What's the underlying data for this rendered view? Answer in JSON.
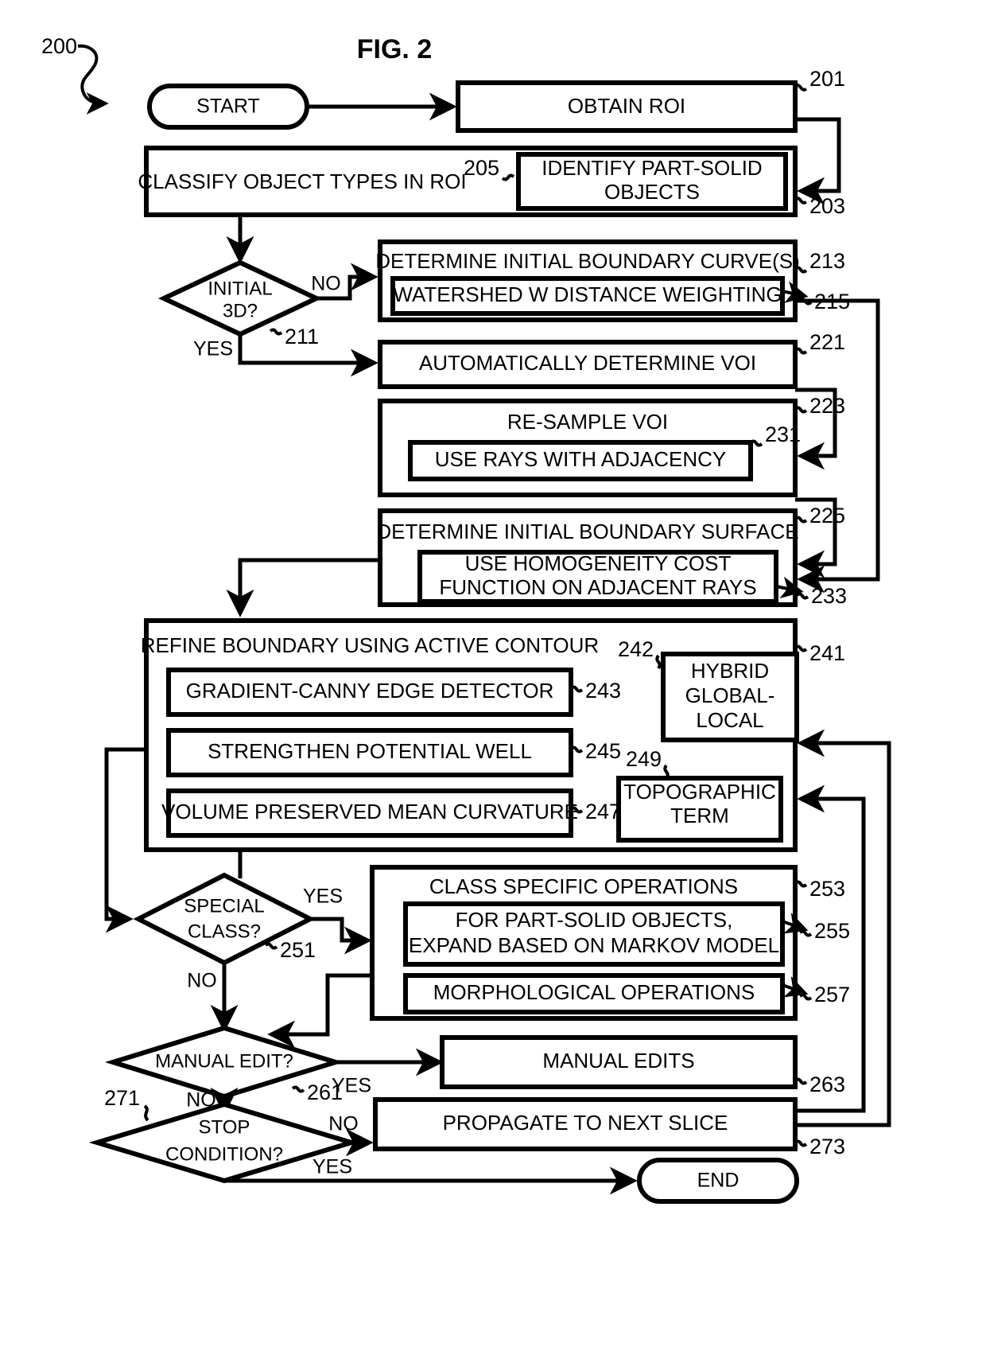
{
  "figure": {
    "title": "FIG. 2",
    "diagram_ref": "200"
  },
  "terminators": {
    "start": "START",
    "end": "END"
  },
  "nodes": {
    "obtain_roi": {
      "label": "OBTAIN ROI",
      "ref": "201"
    },
    "classify": {
      "label": "CLASSIFY OBJECT TYPES IN ROI",
      "ref": "203"
    },
    "identify_part_solid": {
      "label_line1": "IDENTIFY PART-SOLID",
      "label_line2": "OBJECTS",
      "ref": "205"
    },
    "initial_3d": {
      "label_line1": "INITIAL",
      "label_line2": "3D?",
      "ref": "211"
    },
    "determine_curves": {
      "label": "DETERMINE INITIAL BOUNDARY CURVE(S)",
      "ref": "213"
    },
    "watershed": {
      "label": "WATERSHED W DISTANCE WEIGHTING",
      "ref": "215"
    },
    "auto_voi": {
      "label": "AUTOMATICALLY DETERMINE  VOI",
      "ref": "221"
    },
    "resample_voi": {
      "label": "RE-SAMPLE VOI",
      "ref": "223"
    },
    "rays_adjacency": {
      "label": "USE RAYS WITH ADJACENCY",
      "ref": "231"
    },
    "determine_surface": {
      "label": "DETERMINE INITIAL BOUNDARY SURFACE",
      "ref": "225"
    },
    "homogeneity": {
      "label_line1": "USE HOMOGENEITY COST",
      "label_line2": "FUNCTION ON  ADJACENT RAYS",
      "ref": "233"
    },
    "refine_boundary": {
      "label": "REFINE BOUNDARY USING  ACTIVE CONTOUR",
      "ref": "241"
    },
    "hybrid": {
      "label_line1": "HYBRID",
      "label_line2": "GLOBAL-",
      "label_line3": "LOCAL",
      "ref": "242"
    },
    "canny": {
      "label": "GRADIENT-CANNY EDGE DETECTOR",
      "ref": "243"
    },
    "potential_well": {
      "label": "STRENGTHEN POTENTIAL WELL",
      "ref": "245"
    },
    "mean_curvature": {
      "label": "VOLUME PRESERVED MEAN CURVATURE",
      "ref": "247"
    },
    "topographic": {
      "label_line1": "TOPOGRAPHIC",
      "label_line2": "TERM",
      "ref": "249"
    },
    "special_class": {
      "label_line1": "SPECIAL",
      "label_line2": "CLASS?",
      "ref": "251"
    },
    "class_ops": {
      "label": "CLASS SPECIFIC OPERATIONS",
      "ref": "253"
    },
    "markov": {
      "label_line1": "FOR PART-SOLID OBJECTS,",
      "label_line2": "EXPAND BASED ON MARKOV MODEL",
      "ref": "255"
    },
    "morphological": {
      "label": "MORPHOLOGICAL OPERATIONS",
      "ref": "257"
    },
    "manual_edit": {
      "label": "MANUAL EDIT?",
      "ref": "261"
    },
    "manual_edits": {
      "label": "MANUAL EDITS",
      "ref": "263"
    },
    "stop_condition": {
      "label_line1": "STOP",
      "label_line2": "CONDITION?",
      "ref": "271"
    },
    "propagate": {
      "label": "PROPAGATE TO NEXT SLICE",
      "ref": "273"
    }
  },
  "edge_labels": {
    "initial3d_no": "NO",
    "initial3d_yes": "YES",
    "special_yes": "YES",
    "special_no": "NO",
    "manual_yes": "YES",
    "manual_no": "NO",
    "stop_no": "NO",
    "stop_yes": "YES"
  },
  "colors": {
    "stroke": "#000000",
    "fill": "#ffffff"
  }
}
